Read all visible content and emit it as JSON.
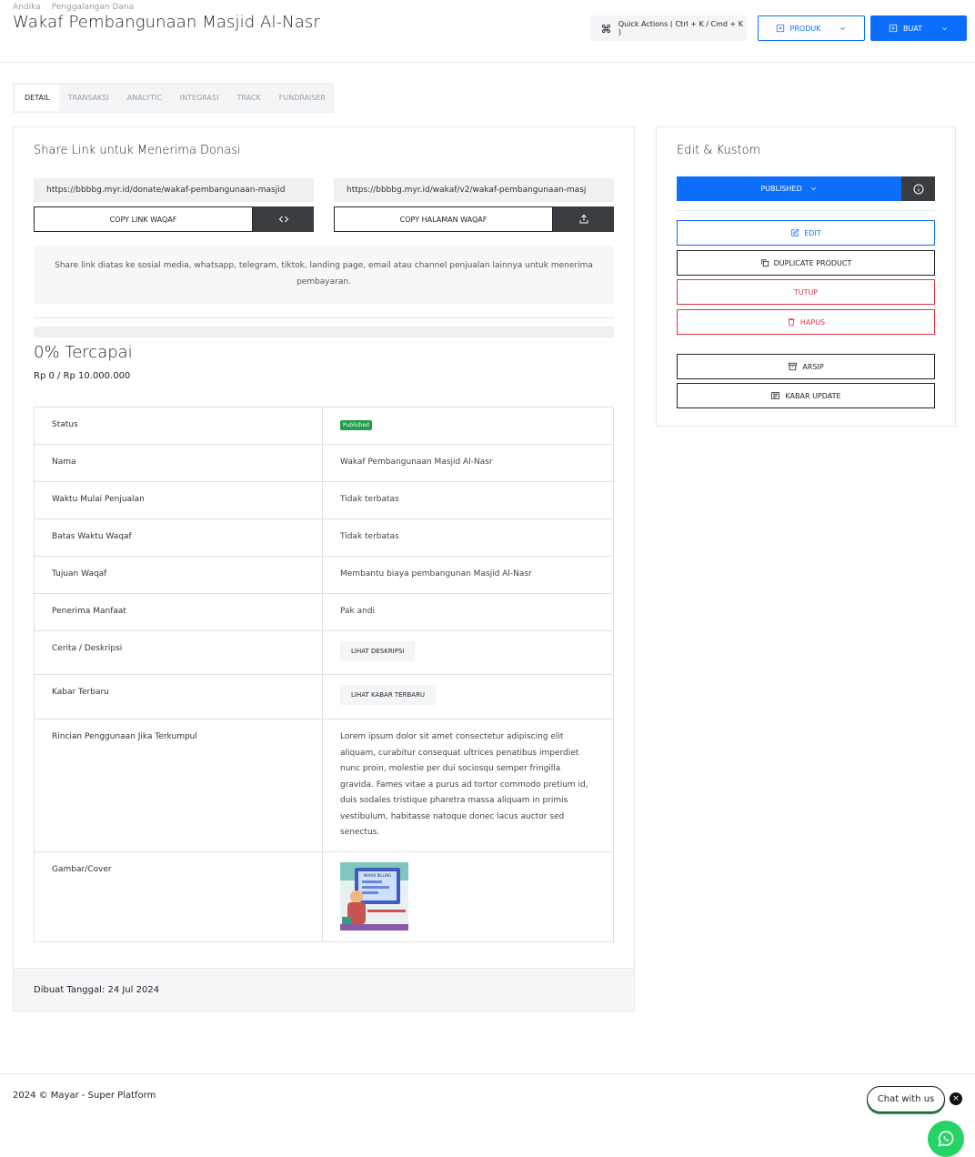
{
  "breadcrumb": [
    "Andika",
    "Penggalangan Dana"
  ],
  "page_title": "Wakaf Pembangunaan Masjid Al-Nasr",
  "header": {
    "quick_actions": "Quick Actions ( Ctrl + K / Cmd + K )",
    "produk_label": "PRODUK",
    "buat_label": "BUAT"
  },
  "tabs": [
    "DETAIL",
    "TRANSAKSI",
    "ANALYTIC",
    "INTEGRASI",
    "TRACK",
    "FUNDRAISER"
  ],
  "share": {
    "title": "Share Link untuk Menerima Donasi",
    "link1": "https://bbbbg.myr.id/donate/wakaf-pembangunaan-masjid",
    "link2": "https://bbbbg.myr.id/wakaf/v2/wakaf-pembangunaan-masj",
    "copy_link_label": "COPY LINK WAQAF",
    "copy_page_label": "COPY HALAMAN WAQAF",
    "info_text": "Share link diatas ke sosial media, whatsapp, telegram, tiktok, landing page, email atau channel penjualan lainnya untuk menerima pembayaran."
  },
  "progress": {
    "percent_text": "0% Tercapai",
    "amount_text": "Rp 0 / Rp 10.000.000",
    "fraction": 0
  },
  "details": {
    "status_label": "Status",
    "status_value": "Published",
    "nama_label": "Nama",
    "nama_value": "Wakaf Pembangunaan Masjid Al-Nasr",
    "mulai_label": "Waktu Mulai Penjualan",
    "mulai_value": "Tidak terbatas",
    "batas_label": "Batas Waktu Waqaf",
    "batas_value": "Tidak terbatas",
    "tujuan_label": "Tujuan Waqaf",
    "tujuan_value": "Membantu biaya pembangunan Masjid Al-Nasr",
    "penerima_label": "Penerima Manfaat",
    "penerima_value": "Pak andi",
    "cerita_label": "Cerita / Deskripsi",
    "cerita_button": "LIHAT DESKRIPSI",
    "kabar_label": "Kabar Terbaru",
    "kabar_button": "LIHAT KABAR TERBARU",
    "rincian_label": "Rincian Penggunaan Jika Terkumpul",
    "rincian_value": "Lorem ipsum dolor sit amet consectetur adipiscing elit aliquam, curabitur consequat ultrices penatibus imperdiet nunc proin, molestie per dui sociosqu semper fringilla gravida. Fames vitae a purus ad tortor commodo pretium id, duis sodales tristique pharetra massa aliquam in primis vestibulum, habitasse natoque donec lacus auctor sed senectus.",
    "gambar_label": "Gambar/Cover",
    "cover_image_text": "MAYAR BILLING"
  },
  "created": "Dibuat Tanggal: 24 Jul 2024",
  "side": {
    "title": "Edit & Kustom",
    "published_label": "PUBLISHED",
    "edit_label": "EDIT",
    "duplicate_label": "DUPLICATE PRODUCT",
    "tutup_label": "TUTUP",
    "hapus_label": "HAPUS",
    "arsip_label": "ARSIP",
    "kabar_update_label": "KABAR UPDATE"
  },
  "footer": {
    "copyright": "2024 © Mayar - Super Platform",
    "chat_label": "Chat with us",
    "close_glyph": "×"
  },
  "colors": {
    "primary": "#0d6efd",
    "danger": "#dc3545",
    "success": "#1e9e4a",
    "dark": "#3a3d40",
    "whatsapp": "#25d366"
  }
}
